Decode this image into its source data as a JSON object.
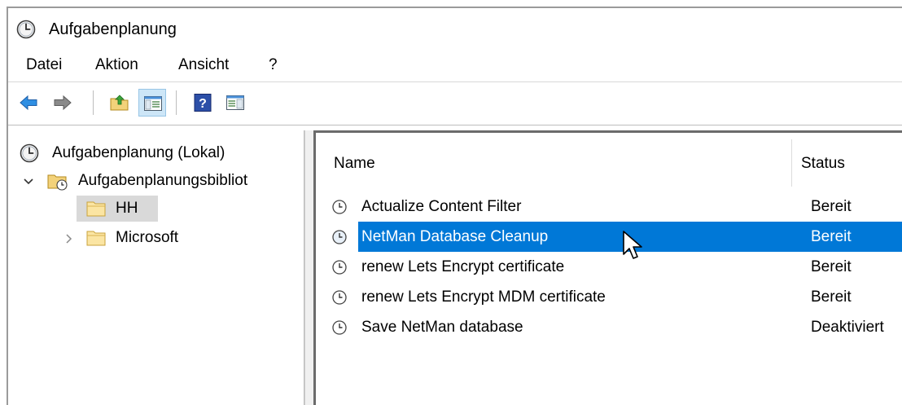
{
  "window": {
    "title": "Aufgabenplanung"
  },
  "menu": [
    "Datei",
    "Aktion",
    "Ansicht",
    "?"
  ],
  "toolbar": {
    "buttons": [
      "back-icon",
      "forward-icon",
      "up-folder-icon",
      "show-hide-console-tree-icon",
      "help-icon",
      "show-hide-action-pane-icon"
    ]
  },
  "tree": {
    "root": "Aufgabenplanung (Lokal)",
    "library": "Aufgabenplanungsbibliot",
    "children": [
      "HH",
      "Microsoft"
    ]
  },
  "list": {
    "columns": {
      "name": "Name",
      "status": "Status"
    },
    "rows": [
      {
        "name": "Actualize Content Filter",
        "status": "Bereit"
      },
      {
        "name": "NetMan Database Cleanup",
        "status": "Bereit"
      },
      {
        "name": "renew Lets Encrypt certificate",
        "status": "Bereit"
      },
      {
        "name": "renew Lets Encrypt MDM certificate",
        "status": "Bereit"
      },
      {
        "name": "Save NetMan database",
        "status": "Deaktiviert"
      }
    ]
  },
  "colors": {
    "selection": "#0078d7",
    "tree_selection": "#d9d9d9",
    "toolbar_active": "#cde6f7"
  }
}
